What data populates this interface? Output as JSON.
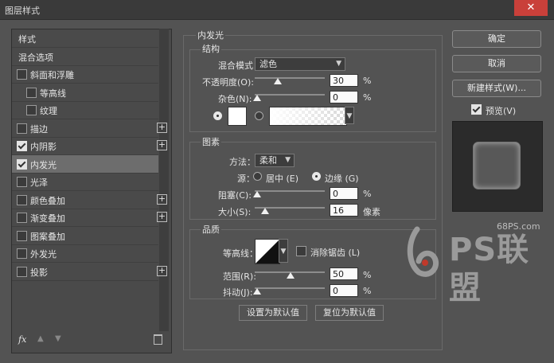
{
  "window": {
    "title": "图层样式",
    "close_glyph": "✕"
  },
  "left": {
    "header": "样式",
    "items": [
      {
        "label": "混合选项",
        "checkbox": false,
        "checked": false,
        "plus": false,
        "indent": false,
        "selected": false
      },
      {
        "label": "斜面和浮雕",
        "checkbox": true,
        "checked": false,
        "plus": false,
        "indent": false,
        "selected": false
      },
      {
        "label": "等高线",
        "checkbox": true,
        "checked": false,
        "plus": false,
        "indent": true,
        "selected": false
      },
      {
        "label": "纹理",
        "checkbox": true,
        "checked": false,
        "plus": false,
        "indent": true,
        "selected": false
      },
      {
        "label": "描边",
        "checkbox": true,
        "checked": false,
        "plus": true,
        "indent": false,
        "selected": false
      },
      {
        "label": "内阴影",
        "checkbox": true,
        "checked": true,
        "plus": true,
        "indent": false,
        "selected": false
      },
      {
        "label": "内发光",
        "checkbox": true,
        "checked": true,
        "plus": false,
        "indent": false,
        "selected": true
      },
      {
        "label": "光泽",
        "checkbox": true,
        "checked": false,
        "plus": false,
        "indent": false,
        "selected": false
      },
      {
        "label": "颜色叠加",
        "checkbox": true,
        "checked": false,
        "plus": true,
        "indent": false,
        "selected": false
      },
      {
        "label": "渐变叠加",
        "checkbox": true,
        "checked": false,
        "plus": true,
        "indent": false,
        "selected": false
      },
      {
        "label": "图案叠加",
        "checkbox": true,
        "checked": false,
        "plus": false,
        "indent": false,
        "selected": false
      },
      {
        "label": "外发光",
        "checkbox": true,
        "checked": false,
        "plus": false,
        "indent": false,
        "selected": false
      },
      {
        "label": "投影",
        "checkbox": true,
        "checked": false,
        "plus": true,
        "indent": false,
        "selected": false
      }
    ],
    "fx_label": "fx"
  },
  "panel": {
    "title": "内发光",
    "structure": {
      "title": "结构",
      "blend_mode_label": "混合模式：",
      "blend_mode_value": "滤色",
      "opacity_label": "不透明度(O):",
      "opacity_value": "30",
      "noise_label": "杂色(N):",
      "noise_value": "0",
      "percent": "%",
      "color_mode": "solid",
      "glow_color": "#ffffff"
    },
    "elements": {
      "title": "图素",
      "technique_label": "方法：",
      "technique_value": "柔和",
      "source_label": "源：",
      "source_center": "居中 (E)",
      "source_edge": "边缘 (G)",
      "source_selected": "edge",
      "choke_label": "阻塞(C):",
      "choke_value": "0",
      "size_label": "大小(S):",
      "size_value": "16",
      "size_unit": "像素",
      "percent": "%"
    },
    "quality": {
      "title": "品质",
      "contour_label": "等高线：",
      "antialias_label": "消除锯齿 (L)",
      "antialias_checked": false,
      "range_label": "范围(R):",
      "range_value": "50",
      "jitter_label": "抖动(J):",
      "jitter_value": "0",
      "percent": "%"
    },
    "set_default": "设置为默认值",
    "reset_default": "复位为默认值"
  },
  "right": {
    "ok": "确定",
    "cancel": "取消",
    "new_style": "新建样式(W)...",
    "preview_label": "预览(V)",
    "preview_checked": true
  },
  "watermark": {
    "site": "68PS.com",
    "brand": "PS联盟"
  }
}
